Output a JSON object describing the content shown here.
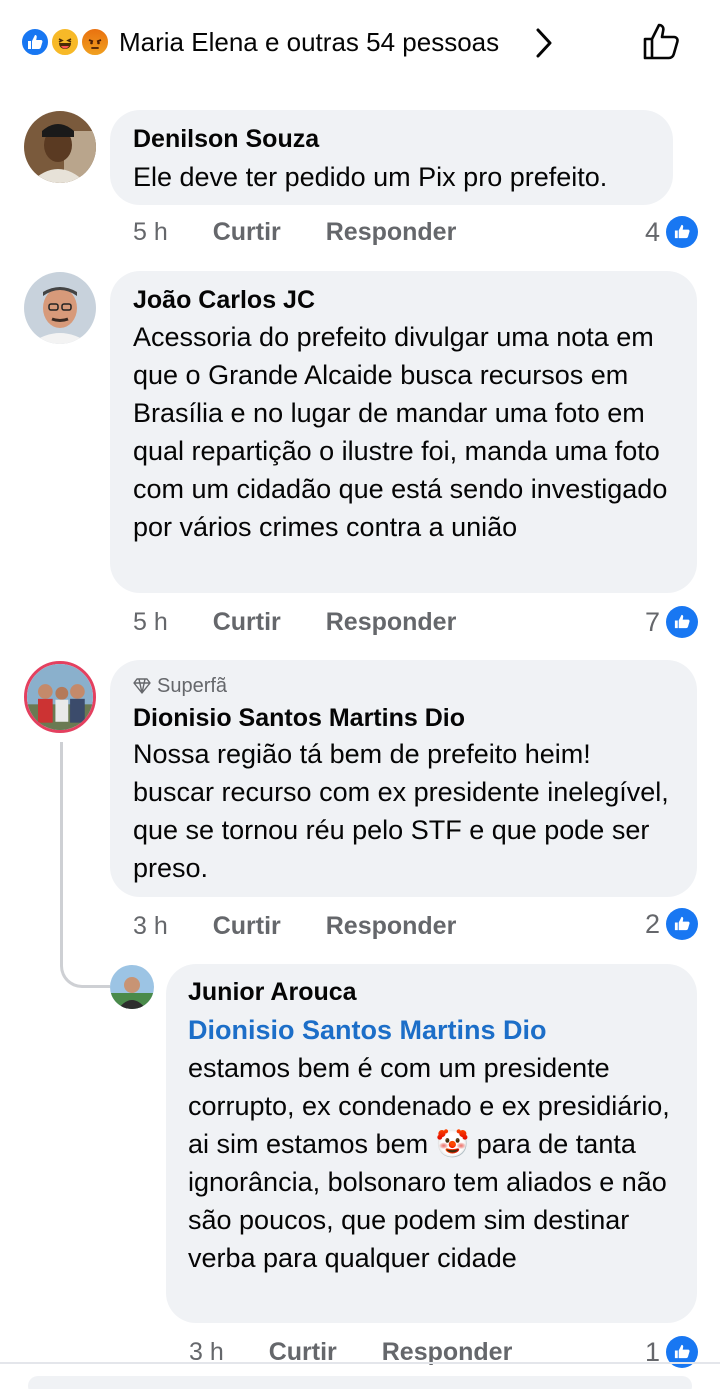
{
  "reactions": {
    "icons": [
      "like-icon",
      "haha-icon",
      "angry-icon"
    ],
    "summary": "Maria Elena e outras 54 pessoas"
  },
  "comments": [
    {
      "author": "Denilson Souza",
      "text": "Ele deve ter pedido um Pix pro prefeito.",
      "time": "5 h",
      "like_label": "Curtir",
      "reply_label": "Responder",
      "likes": "4"
    },
    {
      "author": "João Carlos JC",
      "text": "Acessoria do prefeito divulgar uma nota em que o Grande Alcaide busca recursos em Brasília e no lugar de mandar uma foto em qual repartição o ilustre foi, manda uma foto com um cidadão que está sendo investigado por vários crimes contra a união",
      "time": "5 h",
      "like_label": "Curtir",
      "reply_label": "Responder",
      "likes": "7"
    },
    {
      "badge": "Superfã",
      "author": "Dionisio Santos Martins Dio",
      "text": "Nossa região tá bem de prefeito heim! buscar recurso com ex presidente inelegível, que se tornou réu pelo STF e que pode ser preso.",
      "time": "3 h",
      "like_label": "Curtir",
      "reply_label": "Responder",
      "likes": "2"
    },
    {
      "author": "Junior Arouca",
      "mention": "Dionisio Santos Martins Dio",
      "text_part1": "estamos bem é com um presidente corrupto, ex condenado e ex presidiário, ai sim estamos bem",
      "emoji": "🤡",
      "text_part2": "para de tanta ignorância, bolsonaro tem aliados e não são poucos, que podem sim destinar verba para qualquer cidade",
      "time": "3 h",
      "like_label": "Curtir",
      "reply_label": "Responder",
      "likes": "1"
    }
  ],
  "colors": {
    "bubble": "#f0f2f5",
    "facebook_blue": "#1877f2",
    "mention": "#1c6ec8",
    "secondary_text": "#65676b"
  }
}
